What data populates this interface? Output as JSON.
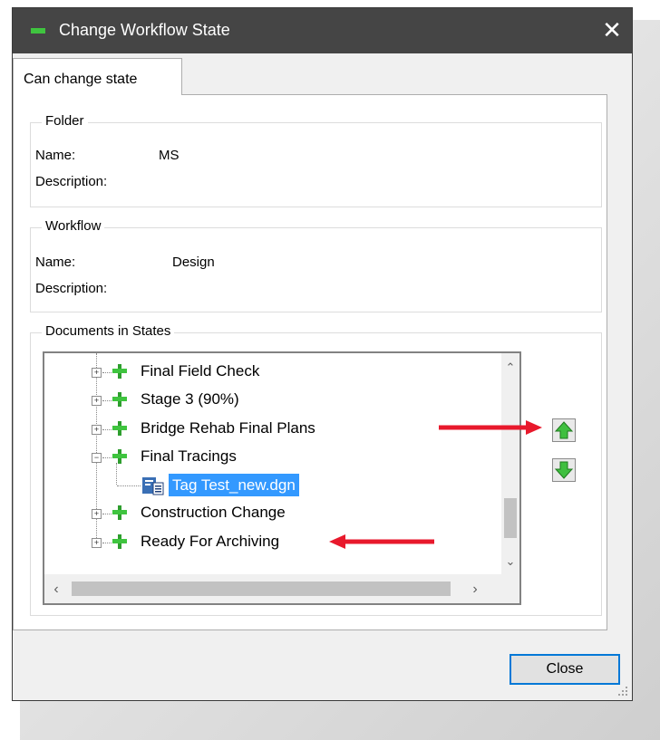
{
  "window": {
    "title": "Change Workflow State",
    "close_glyph": "✕"
  },
  "tabs": [
    {
      "label": "Can change state"
    }
  ],
  "folder": {
    "group_title": "Folder",
    "name_label": "Name:",
    "name_value": "MS",
    "description_label": "Description:",
    "description_value": ""
  },
  "workflow": {
    "group_title": "Workflow",
    "name_label": "Name:",
    "name_value": "Design",
    "description_label": "Description:",
    "description_value": ""
  },
  "documents": {
    "group_title": "Documents in States",
    "tree": [
      {
        "label": "Final Field Check",
        "expanded": false
      },
      {
        "label": "Stage 3 (90%)",
        "expanded": false
      },
      {
        "label": "Bridge Rehab Final Plans",
        "expanded": false
      },
      {
        "label": "Final Tracings",
        "expanded": true
      },
      {
        "label": "Tag Test_new.dgn",
        "selected": true,
        "child": true
      },
      {
        "label": "Construction Change",
        "expanded": false
      },
      {
        "label": "Ready For Archiving",
        "expanded": false
      }
    ],
    "move_up_icon": "green-up-arrow-icon",
    "move_down_icon": "green-down-arrow-icon"
  },
  "buttons": {
    "close_label": "Close"
  },
  "colors": {
    "titlebar": "#454545",
    "selection": "#3399ff",
    "annotation_arrow": "#e8192c",
    "state_icon": "#3fc43f"
  }
}
